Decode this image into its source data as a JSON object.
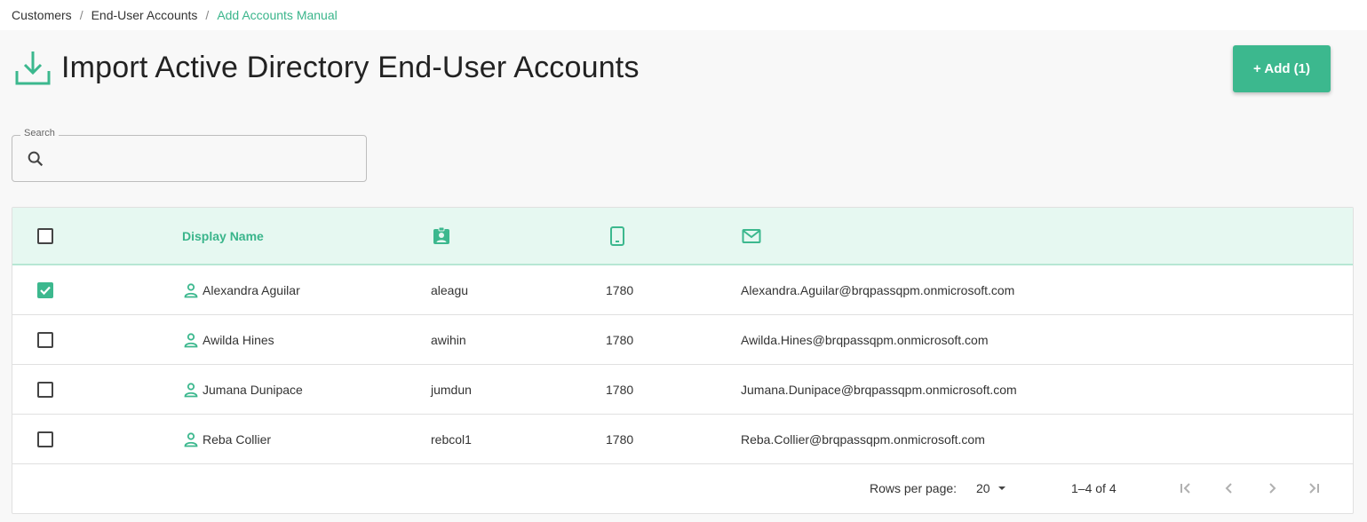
{
  "breadcrumb": {
    "items": [
      "Customers",
      "End-User Accounts"
    ],
    "active": "Add Accounts Manual",
    "separator": "/"
  },
  "page": {
    "title": "Import Active Directory End-User Accounts",
    "icon": "download-icon"
  },
  "actions": {
    "add_label": "+ Add (1)"
  },
  "search": {
    "label": "Search",
    "value": "",
    "placeholder": ""
  },
  "table": {
    "columns": [
      {
        "label": "Display Name",
        "icon": null
      },
      {
        "label": "",
        "icon": "badge-icon"
      },
      {
        "label": "",
        "icon": "phone-icon"
      },
      {
        "label": "",
        "icon": "mail-icon"
      }
    ],
    "rows": [
      {
        "checked": true,
        "name": "Alexandra Aguilar",
        "username": "aleagu",
        "phone": "1780",
        "email": "Alexandra.Aguilar@brqpassqpm.onmicrosoft.com"
      },
      {
        "checked": false,
        "name": "Awilda Hines",
        "username": "awihin",
        "phone": "1780",
        "email": "Awilda.Hines@brqpassqpm.onmicrosoft.com"
      },
      {
        "checked": false,
        "name": "Jumana Dunipace",
        "username": "jumdun",
        "phone": "1780",
        "email": "Jumana.Dunipace@brqpassqpm.onmicrosoft.com"
      },
      {
        "checked": false,
        "name": "Reba Collier",
        "username": "rebcol1",
        "phone": "1780",
        "email": "Reba.Collier@brqpassqpm.onmicrosoft.com"
      }
    ]
  },
  "pagination": {
    "rows_per_page_label": "Rows per page:",
    "rows_per_page_value": "20",
    "range": "1–4 of 4"
  },
  "colors": {
    "accent": "#3cb88e",
    "header_bg": "#e6f8f1"
  }
}
